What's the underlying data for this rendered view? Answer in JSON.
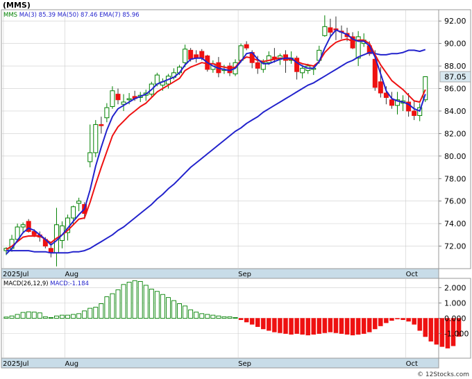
{
  "symbol_label": "(MMS)",
  "legend": [
    {
      "label": "MMS",
      "color": "#008000"
    },
    {
      "label": "MA(3)",
      "color": "#2222cc"
    },
    {
      "label": "85.39",
      "color": "#2222cc"
    },
    {
      "label": "MA(50)",
      "color": "#2222cc"
    },
    {
      "label": "87.46",
      "color": "#2222cc"
    },
    {
      "label": "EMA(7)",
      "color": "#2222cc"
    },
    {
      "label": "85.96",
      "color": "#2222cc"
    }
  ],
  "last_price_label": "87.05",
  "macd_legend": [
    {
      "label": "MACD(26,12,9)",
      "color": "#000000"
    },
    {
      "label": "MACD:-1.184",
      "color": "#2222cc"
    }
  ],
  "watermark": "© 12Stocks.com",
  "colors": {
    "up": "#008000",
    "down": "#ee1111",
    "ma3": "#2222cc",
    "ma50": "#2222cc",
    "ema7": "#ee1111",
    "price_axis_bg": "#d8e8f0",
    "date_strip_bg": "#c8dce8",
    "grid": "#cccccc"
  },
  "chart_data": [
    {
      "type": "candlestick",
      "title": "(MMS)",
      "grid": true,
      "ylim": [
        70.0,
        93.0
      ],
      "y_ticks": [
        72.0,
        74.0,
        76.0,
        78.0,
        80.0,
        82.0,
        84.0,
        86.0,
        88.0,
        90.0,
        92.0
      ],
      "x_tick_labels": [
        {
          "label": "2025Jul",
          "index": 0
        },
        {
          "label": "Aug",
          "index": 11
        },
        {
          "label": "Sep",
          "index": 42
        },
        {
          "label": "Oct",
          "index": 72
        }
      ],
      "candles": [
        [
          71.6,
          71.9,
          71.2,
          71.8
        ],
        [
          71.8,
          73.0,
          71.5,
          72.6
        ],
        [
          72.6,
          74.0,
          72.4,
          73.7
        ],
        [
          73.7,
          74.1,
          73.2,
          73.9
        ],
        [
          74.2,
          74.4,
          73.2,
          73.3
        ],
        [
          73.3,
          73.5,
          72.8,
          73.0
        ],
        [
          73.0,
          73.3,
          72.4,
          72.8
        ],
        [
          72.6,
          72.8,
          71.8,
          72.0
        ],
        [
          71.8,
          72.4,
          71.0,
          71.4
        ],
        [
          71.4,
          75.4,
          70.2,
          73.9
        ],
        [
          72.5,
          74.2,
          71.8,
          73.8
        ],
        [
          73.2,
          74.8,
          72.5,
          74.5
        ],
        [
          74.5,
          75.6,
          73.9,
          75.5
        ],
        [
          75.8,
          76.3,
          75.1,
          76.0
        ],
        [
          75.7,
          75.9,
          74.4,
          74.9
        ],
        [
          79.5,
          82.8,
          79.0,
          80.3
        ],
        [
          80.3,
          83.2,
          79.9,
          82.8
        ],
        [
          82.8,
          83.5,
          82.0,
          82.7
        ],
        [
          83.4,
          84.7,
          83.0,
          84.3
        ],
        [
          84.4,
          86.2,
          84.2,
          85.8
        ],
        [
          85.5,
          86.0,
          84.6,
          85.0
        ],
        [
          84.6,
          85.5,
          84.0,
          84.8
        ],
        [
          85.0,
          85.6,
          84.6,
          85.1
        ],
        [
          85.3,
          85.8,
          84.9,
          85.1
        ],
        [
          85.2,
          85.7,
          84.8,
          85.4
        ],
        [
          85.4,
          85.9,
          84.9,
          85.6
        ],
        [
          85.5,
          86.6,
          85.3,
          86.4
        ],
        [
          86.4,
          87.4,
          86.2,
          87.2
        ],
        [
          86.3,
          86.9,
          85.8,
          86.6
        ],
        [
          86.4,
          87.3,
          86.0,
          87.1
        ],
        [
          87.0,
          87.8,
          86.8,
          87.4
        ],
        [
          87.4,
          88.1,
          87.2,
          87.9
        ],
        [
          88.3,
          89.9,
          87.9,
          89.5
        ],
        [
          89.4,
          89.6,
          88.4,
          88.6
        ],
        [
          89.0,
          89.4,
          88.3,
          88.7
        ],
        [
          89.3,
          89.5,
          88.5,
          88.7
        ],
        [
          88.9,
          89.0,
          87.5,
          87.7
        ],
        [
          87.7,
          88.5,
          87.4,
          88.2
        ],
        [
          88.3,
          88.8,
          87.0,
          87.4
        ],
        [
          87.6,
          88.1,
          87.3,
          87.7
        ],
        [
          88.0,
          88.3,
          87.1,
          87.4
        ],
        [
          87.3,
          88.6,
          87.1,
          88.3
        ],
        [
          88.5,
          90.0,
          88.3,
          89.8
        ],
        [
          89.9,
          90.2,
          89.4,
          89.6
        ],
        [
          89.2,
          89.4,
          87.8,
          88.3
        ],
        [
          88.3,
          88.9,
          87.3,
          87.8
        ],
        [
          87.7,
          88.6,
          87.4,
          88.3
        ],
        [
          88.3,
          89.3,
          88.1,
          88.9
        ],
        [
          88.8,
          89.6,
          88.3,
          88.6
        ],
        [
          88.6,
          89.1,
          88.1,
          88.9
        ],
        [
          89.0,
          89.4,
          87.4,
          88.5
        ],
        [
          88.5,
          89.3,
          88.2,
          88.7
        ],
        [
          88.7,
          88.9,
          86.8,
          87.5
        ],
        [
          87.4,
          88.1,
          86.9,
          87.8
        ],
        [
          87.6,
          88.2,
          87.3,
          88.0
        ],
        [
          87.7,
          88.0,
          87.2,
          87.8
        ],
        [
          88.5,
          89.8,
          88.2,
          89.4
        ],
        [
          90.7,
          92.5,
          90.6,
          91.5
        ],
        [
          91.4,
          92.2,
          90.5,
          91.0
        ],
        [
          91.3,
          92.4,
          90.3,
          91.2
        ],
        [
          91.1,
          91.6,
          90.4,
          91.0
        ],
        [
          90.9,
          91.4,
          90.2,
          90.6
        ],
        [
          90.6,
          91.0,
          89.5,
          89.6
        ],
        [
          88.7,
          91.1,
          88.0,
          90.6
        ],
        [
          90.0,
          90.9,
          89.7,
          90.3
        ],
        [
          89.8,
          90.2,
          88.9,
          89.1
        ],
        [
          88.6,
          89.4,
          85.8,
          86.1
        ],
        [
          86.6,
          87.9,
          85.2,
          85.6
        ],
        [
          85.6,
          86.2,
          84.6,
          85.2
        ],
        [
          85.0,
          85.7,
          84.2,
          84.5
        ],
        [
          84.5,
          85.7,
          83.7,
          85.0
        ],
        [
          84.7,
          85.4,
          84.0,
          84.9
        ],
        [
          84.8,
          85.6,
          83.5,
          84.0
        ],
        [
          84.0,
          84.9,
          83.2,
          83.6
        ],
        [
          83.6,
          84.7,
          83.1,
          84.3
        ],
        [
          85.0,
          87.0,
          84.8,
          87.05
        ]
      ],
      "ma3": [
        71.3,
        71.8,
        72.5,
        73.2,
        73.6,
        73.4,
        73.0,
        72.6,
        72.1,
        72.5,
        73.0,
        73.6,
        74.2,
        74.8,
        75.3,
        77.0,
        79.1,
        80.8,
        82.3,
        83.5,
        84.2,
        84.5,
        84.8,
        85.1,
        85.3,
        85.5,
        85.9,
        86.4,
        86.6,
        86.8,
        87.0,
        87.4,
        88.1,
        88.6,
        88.7,
        88.7,
        88.3,
        88.0,
        87.8,
        87.7,
        87.6,
        87.8,
        88.4,
        89.1,
        89.2,
        88.6,
        88.2,
        88.2,
        88.4,
        88.6,
        88.7,
        88.7,
        88.3,
        88.0,
        87.8,
        87.8,
        88.4,
        89.6,
        90.6,
        91.2,
        91.0,
        90.8,
        90.4,
        90.2,
        90.2,
        89.8,
        88.8,
        87.3,
        85.8,
        85.1,
        84.9,
        84.8,
        84.6,
        84.2,
        84.0,
        85.5
      ],
      "ema7": [
        71.7,
        72.0,
        72.4,
        72.8,
        72.9,
        72.9,
        72.9,
        72.6,
        72.3,
        72.7,
        73.0,
        73.4,
        73.9,
        74.4,
        74.5,
        75.9,
        77.5,
        79.0,
        80.4,
        81.8,
        82.6,
        83.1,
        83.6,
        84.0,
        84.4,
        84.7,
        85.2,
        85.7,
        86.0,
        86.3,
        86.6,
        86.9,
        87.6,
        87.9,
        88.1,
        88.3,
        88.2,
        88.2,
        88.0,
        87.9,
        87.8,
        87.9,
        88.5,
        88.8,
        88.7,
        88.5,
        88.4,
        88.5,
        88.6,
        88.7,
        88.6,
        88.6,
        88.4,
        88.2,
        88.1,
        88.0,
        88.4,
        89.2,
        89.7,
        90.1,
        90.3,
        90.4,
        90.2,
        90.3,
        90.3,
        90.0,
        89.0,
        88.1,
        87.4,
        86.7,
        86.3,
        85.9,
        85.4,
        84.9,
        84.8,
        85.9
      ],
      "ma50": [
        71.6,
        71.6,
        71.6,
        71.6,
        71.6,
        71.5,
        71.5,
        71.5,
        71.4,
        71.4,
        71.4,
        71.4,
        71.5,
        71.5,
        71.6,
        71.8,
        72.1,
        72.4,
        72.7,
        73.0,
        73.4,
        73.7,
        74.1,
        74.5,
        74.9,
        75.3,
        75.7,
        76.2,
        76.6,
        77.1,
        77.5,
        78.0,
        78.5,
        79.0,
        79.4,
        79.8,
        80.2,
        80.6,
        81.0,
        81.4,
        81.8,
        82.2,
        82.5,
        82.9,
        83.2,
        83.5,
        83.9,
        84.2,
        84.5,
        84.8,
        85.1,
        85.4,
        85.7,
        86.0,
        86.3,
        86.5,
        86.8,
        87.1,
        87.4,
        87.7,
        88.0,
        88.3,
        88.5,
        88.8,
        89.0,
        89.2,
        89.1,
        89.0,
        89.0,
        89.1,
        89.1,
        89.2,
        89.4,
        89.4,
        89.3,
        89.46
      ]
    },
    {
      "type": "bar",
      "title": "MACD(26,12,9)",
      "ylim": [
        -2.6,
        2.6
      ],
      "y_ticks": [
        2.0,
        1.0,
        0.0,
        -1.0
      ],
      "x_tick_labels": [
        {
          "label": "2025Jul",
          "index": 0
        },
        {
          "label": "Aug",
          "index": 11
        },
        {
          "label": "Sep",
          "index": 42
        },
        {
          "label": "Oct",
          "index": 72
        }
      ],
      "values": [
        0.08,
        0.15,
        0.25,
        0.38,
        0.42,
        0.4,
        0.35,
        0.1,
        0.05,
        0.15,
        0.2,
        0.2,
        0.25,
        0.3,
        0.48,
        0.65,
        0.72,
        0.95,
        1.4,
        1.6,
        1.85,
        2.2,
        2.35,
        2.45,
        2.4,
        2.15,
        1.9,
        1.75,
        1.55,
        1.35,
        1.15,
        0.95,
        0.8,
        0.55,
        0.4,
        0.3,
        0.25,
        0.2,
        0.15,
        0.1,
        0.1,
        0.05,
        -0.1,
        -0.25,
        -0.4,
        -0.55,
        -0.7,
        -0.8,
        -0.9,
        -0.95,
        -1.0,
        -1.05,
        -1.0,
        -1.05,
        -1.1,
        -1.05,
        -1.0,
        -0.95,
        -0.9,
        -0.95,
        -1.0,
        -1.05,
        -1.1,
        -1.05,
        -1.0,
        -0.9,
        -0.7,
        -0.5,
        -0.3,
        -0.15,
        -0.05,
        -0.1,
        -0.2,
        -0.4,
        -0.8,
        -1.2,
        -1.5,
        -1.7,
        -1.85,
        -1.95,
        -1.8,
        -1.184
      ]
    }
  ]
}
